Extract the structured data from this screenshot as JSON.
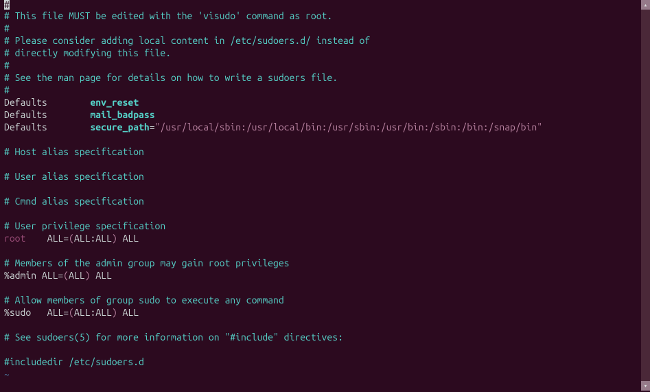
{
  "cursor": "#",
  "lines": {
    "l1": "# This file MUST be edited with the 'visudo' command as root.",
    "l2": "#",
    "l3": "# Please consider adding local content in /etc/sudoers.d/ instead of",
    "l4": "# directly modifying this file.",
    "l5": "#",
    "l6": "# See the man page for details on how to write a sudoers file.",
    "l7": "#",
    "d1_kw": "Defaults",
    "d1_pad": "        ",
    "d1_val": "env_reset",
    "d2_kw": "Defaults",
    "d2_pad": "        ",
    "d2_val": "mail_badpass",
    "d3_kw": "Defaults",
    "d3_pad": "        ",
    "d3_val": "secure_path",
    "d3_eq": "=",
    "d3_str": "\"/usr/local/sbin:/usr/local/bin:/usr/sbin:/usr/bin:/sbin:/bin:/snap/bin\"",
    "l8": "# Host alias specification",
    "l9": "# User alias specification",
    "l10": "# Cmnd alias specification",
    "l11": "# User privilege specification",
    "r_user": "root",
    "r_pad": "    ",
    "r_all1": "ALL",
    "r_eq": "=",
    "r_p1": "(",
    "r_all2": "ALL",
    "r_colon": ":",
    "r_all3": "ALL",
    "r_p2": ")",
    "r_sp": " ",
    "r_all4": "ALL",
    "l12": "# Members of the admin group may gain root privileges",
    "a_user": "%admin",
    "a_sp1": " ",
    "a_all1": "ALL",
    "a_eq": "=",
    "a_p1": "(",
    "a_all2": "ALL",
    "a_p2": ")",
    "a_sp2": " ",
    "a_all3": "ALL",
    "l13": "# Allow members of group sudo to execute any command",
    "s_user": "%sudo",
    "s_pad": "   ",
    "s_all1": "ALL",
    "s_eq": "=",
    "s_p1": "(",
    "s_all2": "ALL",
    "s_colon": ":",
    "s_all3": "ALL",
    "s_p2": ")",
    "s_sp": " ",
    "s_all4": "ALL",
    "l14": "# See sudoers(5) for more information on \"#include\" directives:",
    "inc": "#includedir /etc/sudoers.d",
    "tilde": "~"
  },
  "arrows": {
    "up": "▴",
    "down": "▾"
  }
}
